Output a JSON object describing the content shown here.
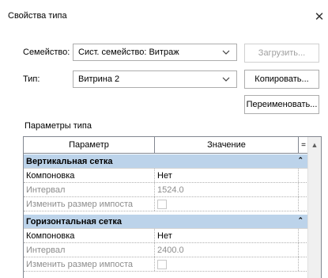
{
  "window": {
    "title": "Свойства типа",
    "close_glyph": "✕"
  },
  "family": {
    "label": "Семейство:",
    "value": "Сист. семейство: Витраж"
  },
  "type": {
    "label": "Тип:",
    "value": "Витрина 2"
  },
  "buttons": {
    "load": "Загрузить...",
    "copy": "Копировать...",
    "rename": "Переименовать..."
  },
  "params_section": {
    "label": "Параметры типа"
  },
  "grid": {
    "col_param": "Параметр",
    "col_value": "Значение",
    "col_sort": "="
  },
  "groups": [
    {
      "name": "Вертикальная сетка",
      "rows": [
        {
          "param": "Компоновка",
          "value": "Нет",
          "enabled": true
        },
        {
          "param": "Интервал",
          "value": "1524.0",
          "enabled": false
        },
        {
          "param": "Изменить размер импоста",
          "value": "",
          "enabled": false,
          "checkbox": true
        }
      ]
    },
    {
      "name": "Горизонтальная сетка",
      "rows": [
        {
          "param": "Компоновка",
          "value": "Нет",
          "enabled": true
        },
        {
          "param": "Интервал",
          "value": "2400.0",
          "enabled": false
        },
        {
          "param": "Изменить размер импоста",
          "value": "",
          "enabled": false,
          "checkbox": true
        }
      ]
    }
  ]
}
